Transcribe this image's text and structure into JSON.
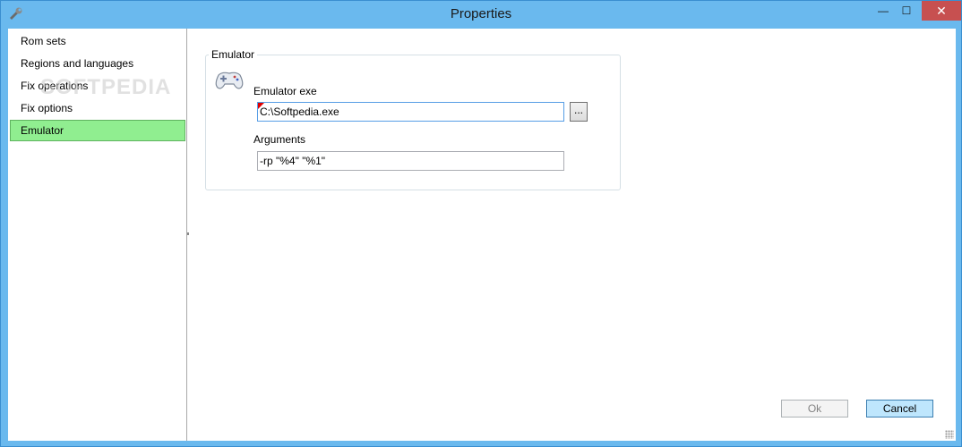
{
  "window": {
    "title": "Properties",
    "minimize_glyph": "—",
    "maximize_glyph": "☐",
    "close_glyph": "✕",
    "app_icon": "wrench-icon",
    "watermark": "SOFTPEDIA"
  },
  "sidebar": {
    "items": [
      {
        "label": "Rom sets",
        "selected": false
      },
      {
        "label": "Regions and languages",
        "selected": false
      },
      {
        "label": "Fix operations",
        "selected": false
      },
      {
        "label": "Fix options",
        "selected": false
      },
      {
        "label": "Emulator",
        "selected": true
      }
    ],
    "selected_color": "#90ee90"
  },
  "emulator_group": {
    "title": "Emulator",
    "icon": "gamepad-icon",
    "exe_label": "Emulator exe",
    "exe_value": "C:\\Softpedia.exe",
    "browse_label": "...",
    "args_label": "Arguments",
    "args_value": "-rp \"%4\" \"%1\""
  },
  "dialog_buttons": {
    "ok_label": "Ok",
    "ok_enabled": false,
    "cancel_label": "Cancel"
  }
}
